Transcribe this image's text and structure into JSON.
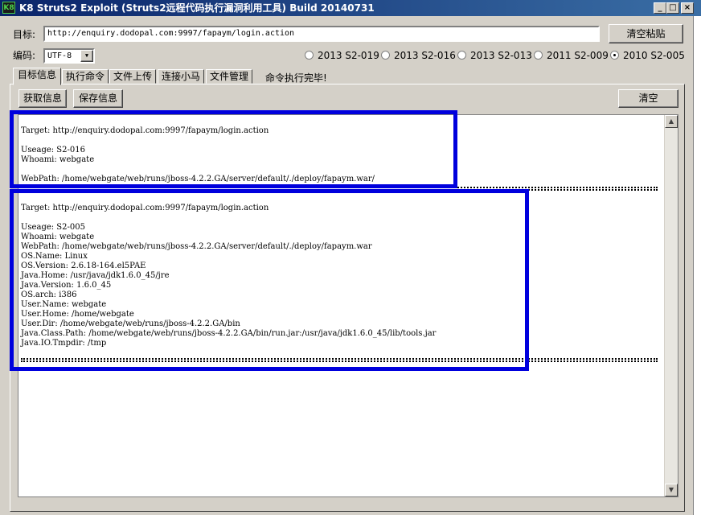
{
  "window": {
    "icon_text": "K8",
    "title": "K8 Struts2 Exploit (Struts2远程代码执行漏洞利用工具) Build 20140731",
    "minimize": "_",
    "maximize": "□",
    "close": "×"
  },
  "target": {
    "label": "目标:",
    "value": "http://enquiry.dodopal.com:9997/fapaym/login.action",
    "clear_paste_button": "清空粘贴"
  },
  "encoding": {
    "label": "编码:",
    "selected": "UTF-8",
    "arrow": "▼"
  },
  "exploits": [
    {
      "label": "2013 S2-019",
      "checked": false
    },
    {
      "label": "2013 S2-016",
      "checked": false
    },
    {
      "label": "2013 S2-013",
      "checked": false
    },
    {
      "label": "2011 S2-009",
      "checked": false
    },
    {
      "label": "2010 S2-005",
      "checked": true
    }
  ],
  "tabs": [
    {
      "label": "目标信息",
      "active": true
    },
    {
      "label": "执行命令",
      "active": false
    },
    {
      "label": "文件上传",
      "active": false
    },
    {
      "label": "连接小马",
      "active": false
    },
    {
      "label": "文件管理",
      "active": false
    }
  ],
  "status": "命令执行完毕!",
  "toolbar": {
    "get_info": "获取信息",
    "save_info": "保存信息",
    "clear": "清空"
  },
  "log": {
    "block1": [
      "Target: http://enquiry.dodopal.com:9997/fapaym/login.action",
      "",
      "Useage: S2-016",
      "Whoami: webgate",
      "",
      "WebPath: /home/webgate/web/runs/jboss-4.2.2.GA/server/default/./deploy/fapaym.war/"
    ],
    "block2": [
      "Target: http://enquiry.dodopal.com:9997/fapaym/login.action",
      "",
      "Useage: S2-005",
      "Whoami: webgate",
      "WebPath: /home/webgate/web/runs/jboss-4.2.2.GA/server/default/./deploy/fapaym.war",
      "OS.Name: Linux",
      "OS.Version: 2.6.18-164.el5PAE",
      "Java.Home: /usr/java/jdk1.6.0_45/jre",
      "Java.Version: 1.6.0_45",
      "OS.arch: i386",
      "User.Name: webgate",
      "User.Home: /home/webgate",
      "User.Dir: /home/webgate/web/runs/jboss-4.2.2.GA/bin",
      "Java.Class.Path: /home/webgate/web/runs/jboss-4.2.2.GA/bin/run.jar:/usr/java/jdk1.6.0_45/lib/tools.jar",
      "Java.IO.Tmpdir: /tmp"
    ]
  },
  "colors": {
    "highlight": "#0000dd",
    "titlebar": "#0a246a"
  }
}
